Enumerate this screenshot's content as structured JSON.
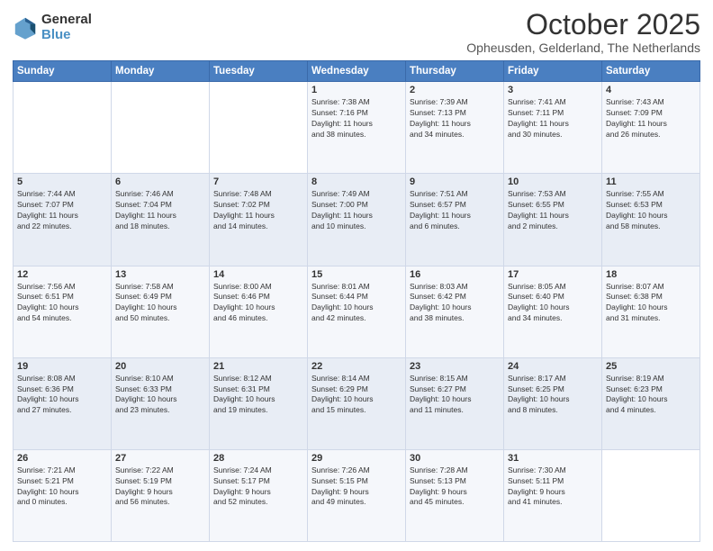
{
  "logo": {
    "general": "General",
    "blue": "Blue"
  },
  "header": {
    "month": "October 2025",
    "location": "Opheusden, Gelderland, The Netherlands"
  },
  "weekdays": [
    "Sunday",
    "Monday",
    "Tuesday",
    "Wednesday",
    "Thursday",
    "Friday",
    "Saturday"
  ],
  "weeks": [
    [
      {
        "day": "",
        "info": ""
      },
      {
        "day": "",
        "info": ""
      },
      {
        "day": "",
        "info": ""
      },
      {
        "day": "1",
        "info": "Sunrise: 7:38 AM\nSunset: 7:16 PM\nDaylight: 11 hours\nand 38 minutes."
      },
      {
        "day": "2",
        "info": "Sunrise: 7:39 AM\nSunset: 7:13 PM\nDaylight: 11 hours\nand 34 minutes."
      },
      {
        "day": "3",
        "info": "Sunrise: 7:41 AM\nSunset: 7:11 PM\nDaylight: 11 hours\nand 30 minutes."
      },
      {
        "day": "4",
        "info": "Sunrise: 7:43 AM\nSunset: 7:09 PM\nDaylight: 11 hours\nand 26 minutes."
      }
    ],
    [
      {
        "day": "5",
        "info": "Sunrise: 7:44 AM\nSunset: 7:07 PM\nDaylight: 11 hours\nand 22 minutes."
      },
      {
        "day": "6",
        "info": "Sunrise: 7:46 AM\nSunset: 7:04 PM\nDaylight: 11 hours\nand 18 minutes."
      },
      {
        "day": "7",
        "info": "Sunrise: 7:48 AM\nSunset: 7:02 PM\nDaylight: 11 hours\nand 14 minutes."
      },
      {
        "day": "8",
        "info": "Sunrise: 7:49 AM\nSunset: 7:00 PM\nDaylight: 11 hours\nand 10 minutes."
      },
      {
        "day": "9",
        "info": "Sunrise: 7:51 AM\nSunset: 6:57 PM\nDaylight: 11 hours\nand 6 minutes."
      },
      {
        "day": "10",
        "info": "Sunrise: 7:53 AM\nSunset: 6:55 PM\nDaylight: 11 hours\nand 2 minutes."
      },
      {
        "day": "11",
        "info": "Sunrise: 7:55 AM\nSunset: 6:53 PM\nDaylight: 10 hours\nand 58 minutes."
      }
    ],
    [
      {
        "day": "12",
        "info": "Sunrise: 7:56 AM\nSunset: 6:51 PM\nDaylight: 10 hours\nand 54 minutes."
      },
      {
        "day": "13",
        "info": "Sunrise: 7:58 AM\nSunset: 6:49 PM\nDaylight: 10 hours\nand 50 minutes."
      },
      {
        "day": "14",
        "info": "Sunrise: 8:00 AM\nSunset: 6:46 PM\nDaylight: 10 hours\nand 46 minutes."
      },
      {
        "day": "15",
        "info": "Sunrise: 8:01 AM\nSunset: 6:44 PM\nDaylight: 10 hours\nand 42 minutes."
      },
      {
        "day": "16",
        "info": "Sunrise: 8:03 AM\nSunset: 6:42 PM\nDaylight: 10 hours\nand 38 minutes."
      },
      {
        "day": "17",
        "info": "Sunrise: 8:05 AM\nSunset: 6:40 PM\nDaylight: 10 hours\nand 34 minutes."
      },
      {
        "day": "18",
        "info": "Sunrise: 8:07 AM\nSunset: 6:38 PM\nDaylight: 10 hours\nand 31 minutes."
      }
    ],
    [
      {
        "day": "19",
        "info": "Sunrise: 8:08 AM\nSunset: 6:36 PM\nDaylight: 10 hours\nand 27 minutes."
      },
      {
        "day": "20",
        "info": "Sunrise: 8:10 AM\nSunset: 6:33 PM\nDaylight: 10 hours\nand 23 minutes."
      },
      {
        "day": "21",
        "info": "Sunrise: 8:12 AM\nSunset: 6:31 PM\nDaylight: 10 hours\nand 19 minutes."
      },
      {
        "day": "22",
        "info": "Sunrise: 8:14 AM\nSunset: 6:29 PM\nDaylight: 10 hours\nand 15 minutes."
      },
      {
        "day": "23",
        "info": "Sunrise: 8:15 AM\nSunset: 6:27 PM\nDaylight: 10 hours\nand 11 minutes."
      },
      {
        "day": "24",
        "info": "Sunrise: 8:17 AM\nSunset: 6:25 PM\nDaylight: 10 hours\nand 8 minutes."
      },
      {
        "day": "25",
        "info": "Sunrise: 8:19 AM\nSunset: 6:23 PM\nDaylight: 10 hours\nand 4 minutes."
      }
    ],
    [
      {
        "day": "26",
        "info": "Sunrise: 7:21 AM\nSunset: 5:21 PM\nDaylight: 10 hours\nand 0 minutes."
      },
      {
        "day": "27",
        "info": "Sunrise: 7:22 AM\nSunset: 5:19 PM\nDaylight: 9 hours\nand 56 minutes."
      },
      {
        "day": "28",
        "info": "Sunrise: 7:24 AM\nSunset: 5:17 PM\nDaylight: 9 hours\nand 52 minutes."
      },
      {
        "day": "29",
        "info": "Sunrise: 7:26 AM\nSunset: 5:15 PM\nDaylight: 9 hours\nand 49 minutes."
      },
      {
        "day": "30",
        "info": "Sunrise: 7:28 AM\nSunset: 5:13 PM\nDaylight: 9 hours\nand 45 minutes."
      },
      {
        "day": "31",
        "info": "Sunrise: 7:30 AM\nSunset: 5:11 PM\nDaylight: 9 hours\nand 41 minutes."
      },
      {
        "day": "",
        "info": ""
      }
    ]
  ]
}
